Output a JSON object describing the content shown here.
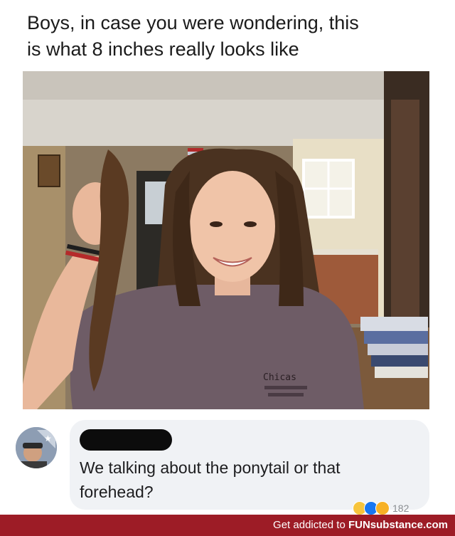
{
  "caption": {
    "line1": "Boys, in case you were wondering, this",
    "line2": "is what 8 inches really looks like"
  },
  "photo": {
    "shirt_text": "Chicas"
  },
  "comment": {
    "text_line1": "We talking about the ponytail or that",
    "text_line2": "forehead?",
    "reaction_count": "182"
  },
  "footer": {
    "prefix": "Get addicted to ",
    "brand": "FUNsubstance.com"
  },
  "colors": {
    "footer_bg": "#9d1c26",
    "bubble_bg": "#f0f2f5"
  }
}
